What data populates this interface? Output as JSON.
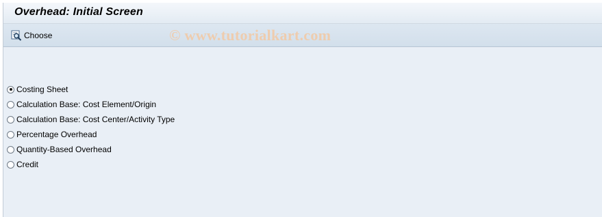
{
  "window": {
    "title": "Overhead: Initial Screen"
  },
  "toolbar": {
    "choose_label": "Choose",
    "choose_icon": "choose-magnifier-icon"
  },
  "watermark": {
    "text": "© www.tutorialkart.com"
  },
  "options": [
    {
      "label": "Costing Sheet",
      "selected": true
    },
    {
      "label": "Calculation Base: Cost Element/Origin",
      "selected": false
    },
    {
      "label": "Calculation Base: Cost Center/Activity Type",
      "selected": false
    },
    {
      "label": "Percentage Overhead",
      "selected": false
    },
    {
      "label": "Quantity-Based Overhead",
      "selected": false
    },
    {
      "label": "Credit",
      "selected": false
    }
  ],
  "colors": {
    "background": "#e9eff6",
    "toolbar": "#d8e3ee",
    "watermark": "#f3c9a4"
  }
}
